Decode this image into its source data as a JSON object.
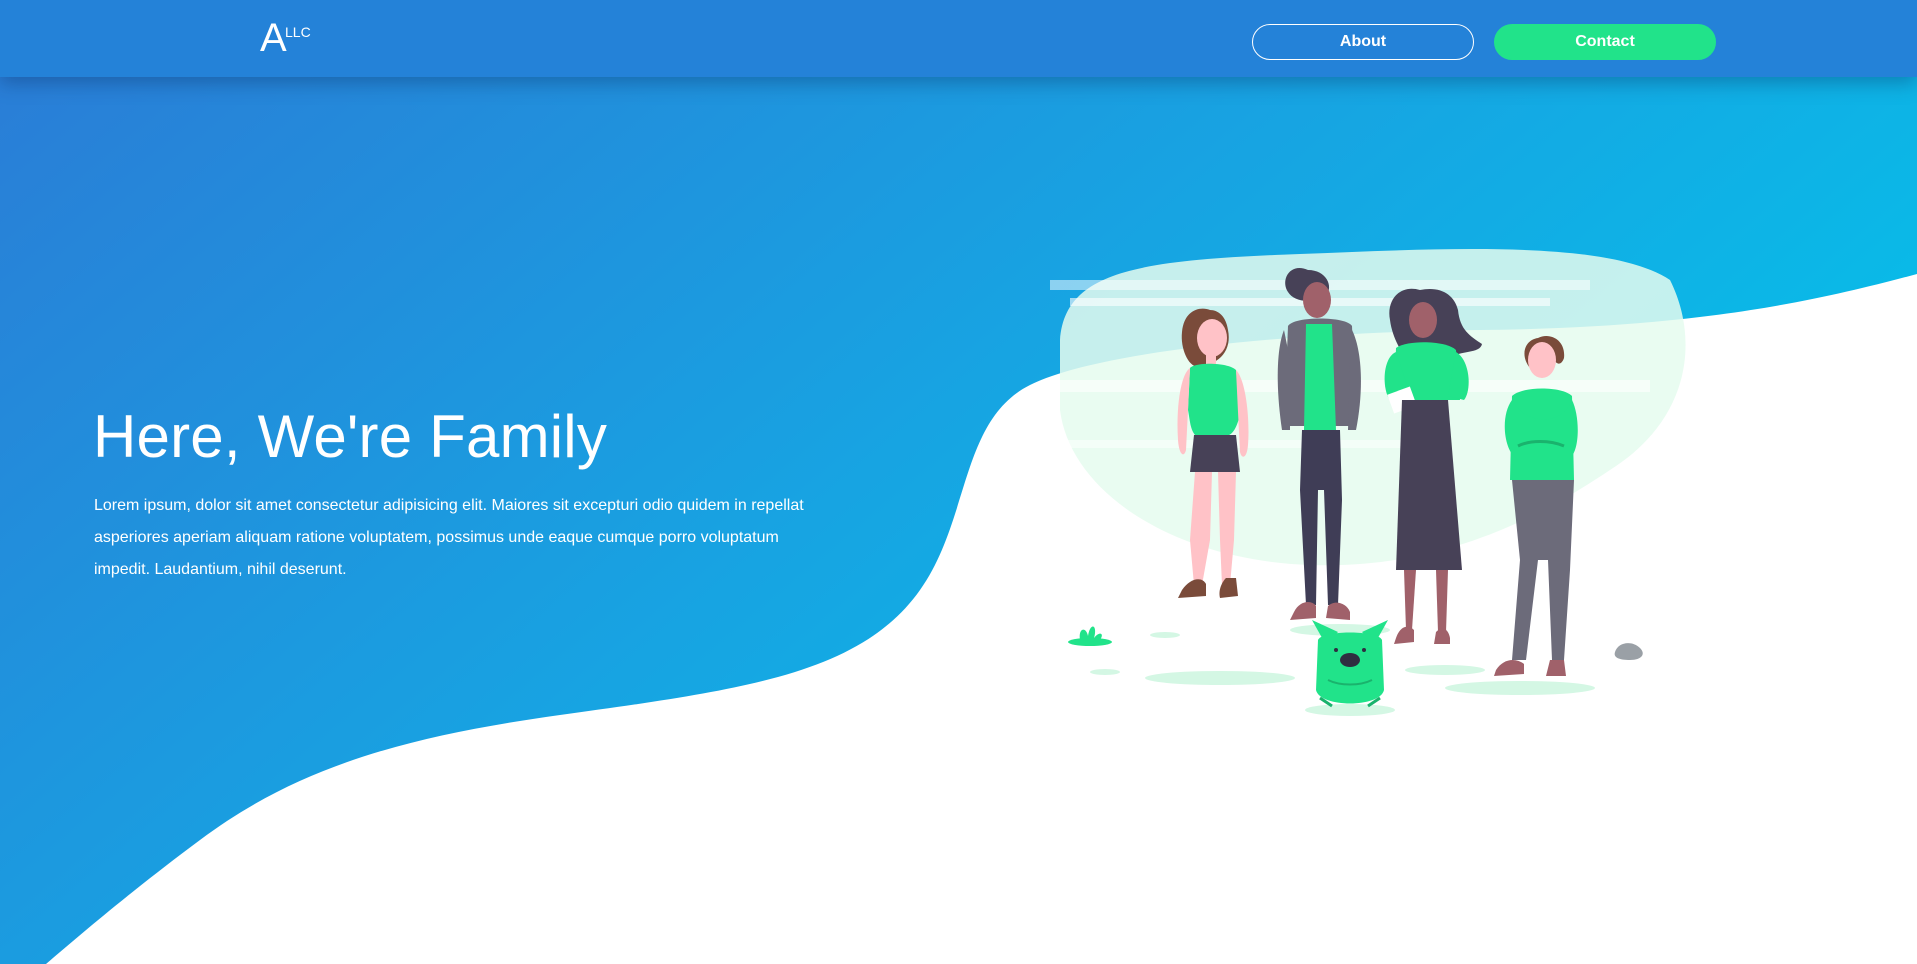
{
  "brand": {
    "logo_letter": "A",
    "logo_superscript": "LLC"
  },
  "nav": {
    "about_label": "About",
    "contact_label": "Contact"
  },
  "hero": {
    "title": "Here, We're Family",
    "body": "Lorem ipsum, dolor sit amet consectetur adipisicing elit. Maiores sit excepturi odio quidem in repellat asperiores aperiam aliquam ratione voluptatem, possimus unde eaque cumque porro voluptatum impedit. Laudantium, nihil deserunt."
  },
  "illustration": {
    "icon": "people-group-with-dog-illustration"
  },
  "colors": {
    "navbar": "#2482d8",
    "gradient_start": "#2b7bd6",
    "gradient_end": "#04c3ea",
    "accent_green": "#21e38a",
    "text_light": "#ffffff"
  }
}
